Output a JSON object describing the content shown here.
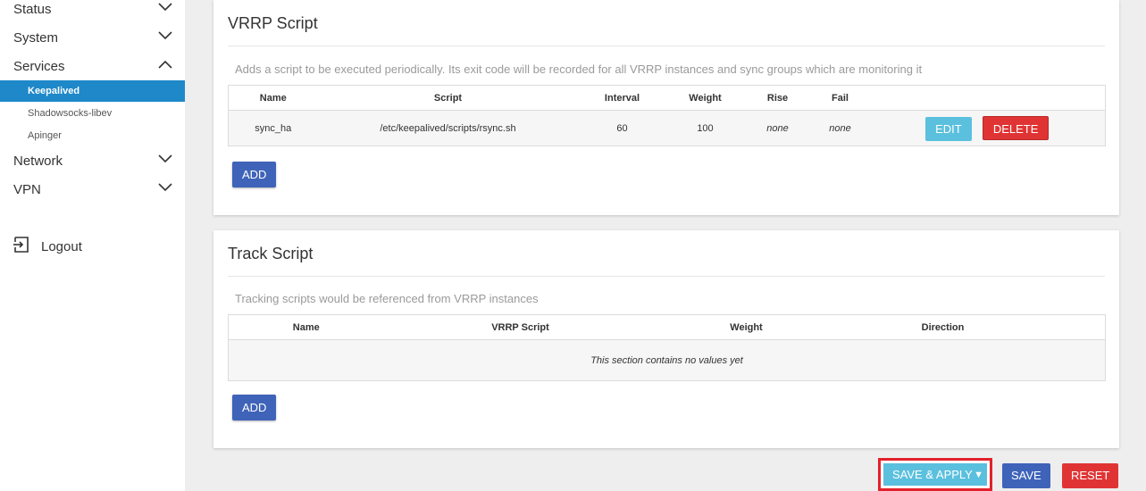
{
  "sidebar": {
    "menus": [
      {
        "label": "Status",
        "expanded": false
      },
      {
        "label": "System",
        "expanded": false
      },
      {
        "label": "Services",
        "expanded": true
      },
      {
        "label": "Network",
        "expanded": false
      },
      {
        "label": "VPN",
        "expanded": false
      }
    ],
    "services_sub": [
      "Keepalived",
      "Shadowsocks-libev",
      "Apinger"
    ],
    "logout_label": "Logout"
  },
  "vrrp": {
    "title": "VRRP Script",
    "description": "Adds a script to be executed periodically. Its exit code will be recorded for all VRRP instances and sync groups which are monitoring it",
    "columns": [
      "Name",
      "Script",
      "Interval",
      "Weight",
      "Rise",
      "Fail"
    ],
    "rows": [
      {
        "name": "sync_ha",
        "script": "/etc/keepalived/scripts/rsync.sh",
        "interval": "60",
        "weight": "100",
        "rise": "none",
        "fail": "none"
      }
    ],
    "edit_label": "EDIT",
    "delete_label": "DELETE",
    "add_label": "ADD"
  },
  "track": {
    "title": "Track Script",
    "description": "Tracking scripts would be referenced from VRRP instances",
    "columns": [
      "Name",
      "VRRP Script",
      "Weight",
      "Direction"
    ],
    "empty_text": "This section contains no values yet",
    "add_label": "ADD"
  },
  "footer": {
    "save_apply_label": "SAVE & APPLY",
    "save_label": "SAVE",
    "reset_label": "RESET"
  },
  "colors": {
    "active_menu": "#1e88c9",
    "primary": "#3f63b9",
    "info": "#5bc0de",
    "danger": "#e03434",
    "highlight_border": "#e2212b"
  }
}
